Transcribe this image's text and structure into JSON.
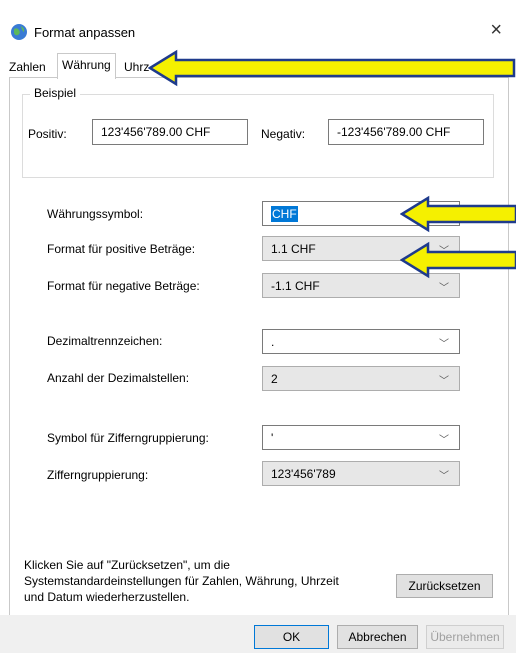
{
  "window": {
    "title": "Format anpassen",
    "close_glyph": "×"
  },
  "tabs": [
    {
      "label": "Zahlen"
    },
    {
      "label": "Währung"
    },
    {
      "label": "Uhrz"
    }
  ],
  "example": {
    "group_label": "Beispiel",
    "positive_label": "Positiv:",
    "positive_value": "123'456'789.00 CHF",
    "negative_label": "Negativ:",
    "negative_value": "-123'456'789.00 CHF"
  },
  "settings": {
    "currency_symbol_label": "Währungssymbol:",
    "currency_symbol_value": "CHF",
    "positive_format_label": "Format für positive Beträge:",
    "positive_format_value": "1.1 CHF",
    "negative_format_label": "Format für negative Beträge:",
    "negative_format_value": "-1.1 CHF",
    "decimal_sep_label": "Dezimaltrennzeichen:",
    "decimal_sep_value": ".",
    "decimal_places_label": "Anzahl der Dezimalstellen:",
    "decimal_places_value": "2",
    "group_symbol_label": "Symbol für Zifferngruppierung:",
    "group_symbol_value": "'",
    "grouping_label": "Zifferngruppierung:",
    "grouping_value": "123'456'789"
  },
  "reset": {
    "line1": "Klicken Sie auf \"Zurücksetzen\", um die",
    "line2": "Systemstandardeinstellungen für Zahlen, Währung, Uhrzeit",
    "line3": "und Datum wiederherzustellen.",
    "button": "Zurücksetzen"
  },
  "buttons": {
    "ok": "OK",
    "cancel": "Abbrechen",
    "apply": "Übernehmen"
  },
  "colors": {
    "selection": "#0078d7",
    "arrow_fill": "#f5f000",
    "arrow_stroke": "#1f3b8c"
  }
}
